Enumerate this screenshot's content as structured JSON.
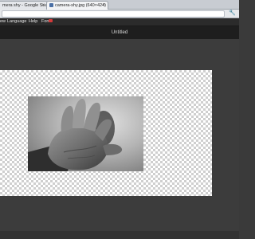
{
  "browser": {
    "tabs": [
      {
        "title": "mera shy - Google Search",
        "close": "×"
      },
      {
        "title": "camera-shy.jpg (640×424)",
        "close": "×"
      }
    ],
    "menu_icon": "wrench-icon"
  },
  "menubar": {
    "items": [
      "ew",
      "Language",
      "Help",
      "Font"
    ],
    "badge_color": "#d43a3a"
  },
  "document": {
    "title": "Untitled"
  },
  "colors": {
    "workspace": "#3c3c3c",
    "titlebar": "#1e1e1e",
    "menubar": "#2b2b2b"
  },
  "icons": {
    "new_badge": "new-badge-icon"
  }
}
